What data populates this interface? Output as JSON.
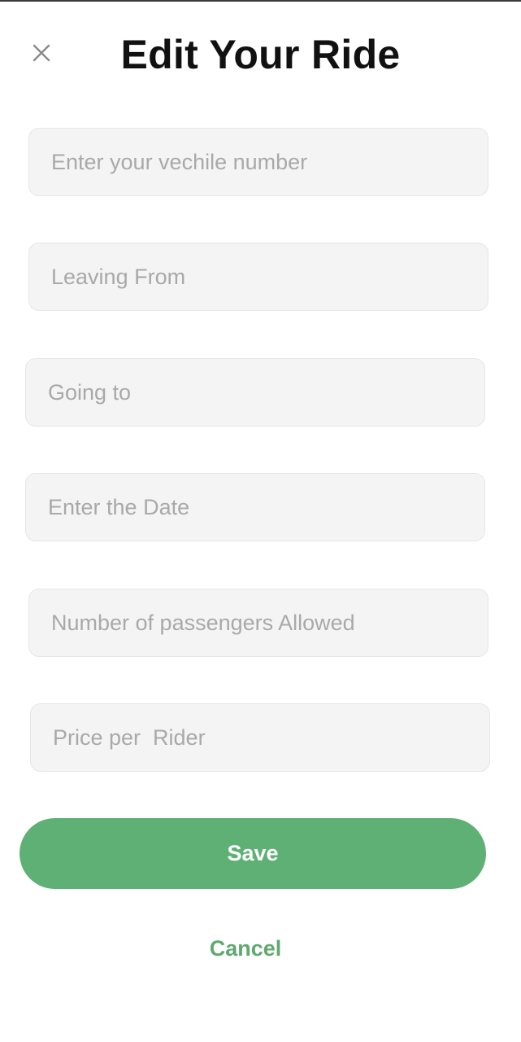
{
  "header": {
    "title": "Edit Your Ride",
    "close_icon": "close-icon"
  },
  "form": {
    "fields": [
      {
        "name": "vehicle-number-field",
        "placeholder": "Enter your vechile number",
        "value": ""
      },
      {
        "name": "leaving-from-field",
        "placeholder": "Leaving From",
        "value": ""
      },
      {
        "name": "going-to-field",
        "placeholder": "Going to",
        "value": ""
      },
      {
        "name": "date-field",
        "placeholder": "Enter the Date",
        "value": ""
      },
      {
        "name": "passengers-allowed-field",
        "placeholder": "Number of passengers Allowed",
        "value": ""
      },
      {
        "name": "price-per-rider-field",
        "placeholder": "Price per  Rider",
        "value": ""
      }
    ]
  },
  "actions": {
    "save_label": "Save",
    "cancel_label": "Cancel"
  },
  "colors": {
    "accent": "#5fb074",
    "cancel_text": "#5fa870",
    "field_bg": "#f4f4f4",
    "placeholder": "#a9a9a9"
  }
}
